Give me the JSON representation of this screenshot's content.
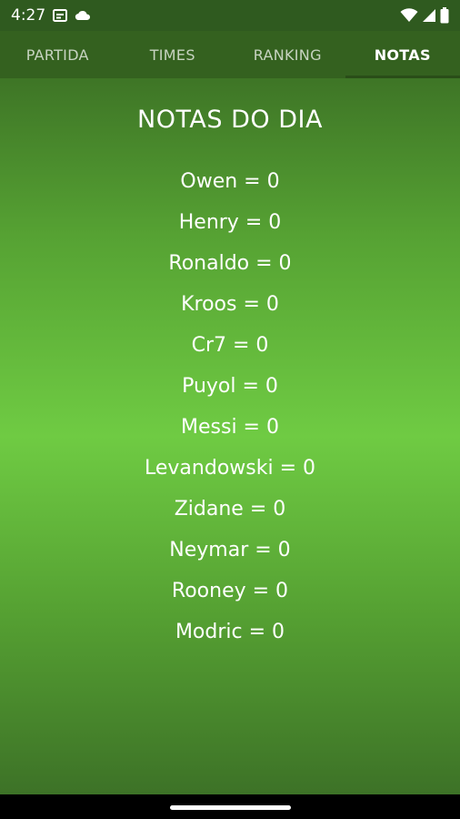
{
  "status_bar": {
    "time": "4:27",
    "icons": [
      "sim-card-icon",
      "cloud-icon",
      "wifi-icon",
      "signal-icon",
      "battery-icon"
    ]
  },
  "tabs": [
    {
      "label": "PARTIDA",
      "active": false
    },
    {
      "label": "TIMES",
      "active": false
    },
    {
      "label": "RANKING",
      "active": false
    },
    {
      "label": "NOTAS",
      "active": true
    }
  ],
  "page": {
    "title": "NOTAS DO DIA",
    "grades": [
      "Owen = 0",
      "Henry = 0",
      "Ronaldo = 0",
      "Kroos = 0",
      "Cr7 = 0",
      "Puyol = 0",
      "Messi = 0",
      "Levandowski = 0",
      "Zidane = 0",
      "Neymar = 0",
      "Rooney = 0",
      "Modric = 0"
    ]
  },
  "colors": {
    "status_bar": "#2f5a1f",
    "tab_bar": "#34611f",
    "background_center": "#6fcb43",
    "background_edge": "#3d7227",
    "text": "#ffffff"
  }
}
